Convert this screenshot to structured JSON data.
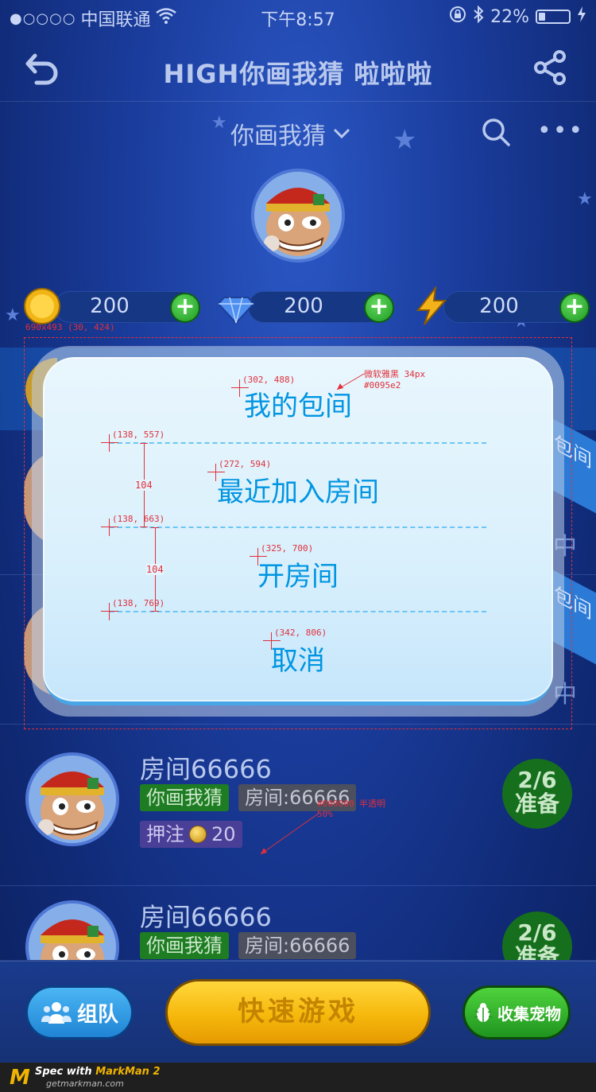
{
  "status_bar": {
    "signal_dots": "●○○○○",
    "carrier": "中国联通",
    "time": "下午8:57",
    "battery": "22%",
    "battery_level": 0.22
  },
  "nav": {
    "title": "HIGH你画我猜 啦啦啦"
  },
  "sub_header": {
    "game_selector": "你画我猜",
    "more": "•••"
  },
  "currency": [
    {
      "icon": "coin-icon",
      "value": "200"
    },
    {
      "icon": "diamond-icon",
      "value": "200"
    },
    {
      "icon": "lightning-icon",
      "value": "200"
    }
  ],
  "plus_label": "+",
  "list": {
    "items": [
      {
        "title": "房间66666",
        "game_tag": "你画我猜",
        "room_tag": "房间:66666",
        "bet_label": "押注",
        "bet_value": "20",
        "status_line1": "2/6",
        "status_line2": "准备"
      },
      {
        "title": "房间66666",
        "game_tag": "你画我猜",
        "room_tag": "房间:66666",
        "status_line1": "2/6",
        "status_line2": "准备"
      }
    ],
    "ribbon_label": "包间",
    "side_char": "中"
  },
  "modal": {
    "items": [
      "我的包间",
      "最近加入房间",
      "开房间",
      "取消"
    ]
  },
  "annotations": {
    "box": "690x493 (30, 424)",
    "p1": "(302, 488)",
    "font_note": "微软雅黑 34px",
    "color_note": "#0095e2",
    "p2": "(138, 557)",
    "p3": "(272, 594)",
    "gap1": "104",
    "p4": "(138, 663)",
    "p5": "(325, 700)",
    "gap2": "104",
    "p6": "(138, 769)",
    "p7": "(342, 806)",
    "overlay_note1": "#000000 半透明",
    "overlay_note2": "50%"
  },
  "bottom": {
    "team": "组队",
    "quick": "快速游戏",
    "pet": "收集宠物"
  },
  "footer": {
    "logo": "M",
    "spec_prefix": "Spec with ",
    "spec_brand": "MarkMan 2",
    "site": "getmarkman.com"
  },
  "colors": {
    "modal_text": "#0095e2",
    "annotation": "#e0303a",
    "quick_button": "#f6b80c",
    "pet_button": "#1f941f",
    "team_button": "#1f84d4"
  }
}
